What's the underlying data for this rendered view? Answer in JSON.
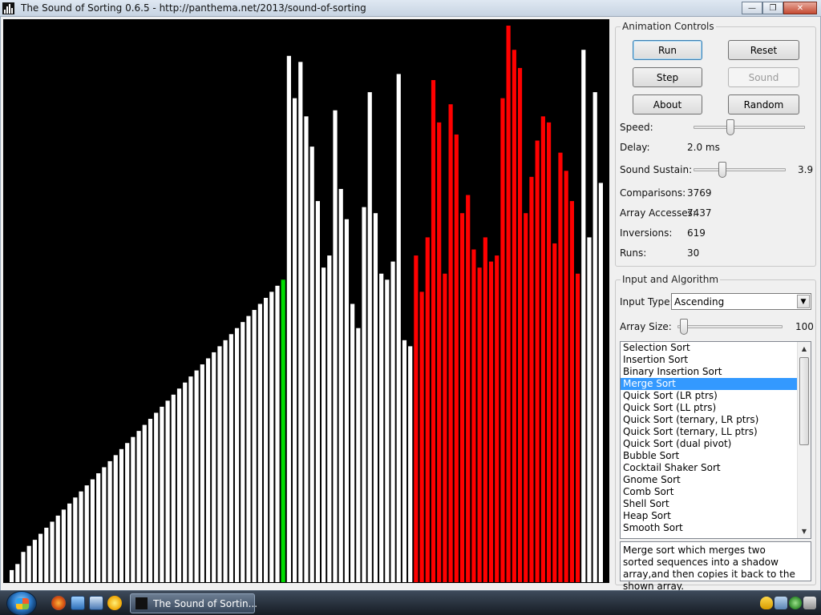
{
  "window": {
    "title": "The Sound of Sorting 0.6.5 - http://panthema.net/2013/sound-of-sorting",
    "minimize_glyph": "—",
    "maximize_glyph": "❐",
    "close_glyph": "✕"
  },
  "animation_controls": {
    "legend": "Animation Controls",
    "run_label": "Run",
    "reset_label": "Reset",
    "step_label": "Step",
    "sound_label": "Sound",
    "about_label": "About",
    "random_label": "Random",
    "speed_label": "Speed:",
    "speed_level": 0.33,
    "delay_label": "Delay:",
    "delay_value": "2.0 ms",
    "sustain_label": "Sound Sustain:",
    "sustain_level": 0.31,
    "sustain_value": "3.9",
    "comparisons_label": "Comparisons:",
    "comparisons_value": "3769",
    "accesses_label": "Array Accesses:",
    "accesses_value": "7437",
    "inversions_label": "Inversions:",
    "inversions_value": "619",
    "runs_label": "Runs:",
    "runs_value": "30"
  },
  "input_algorithm": {
    "legend": "Input and Algorithm",
    "input_type_label": "Input Type:",
    "input_type_value": "Ascending",
    "array_size_label": "Array Size:",
    "array_size_level": 0.06,
    "array_size_value": "100",
    "algorithms": [
      "Selection Sort",
      "Insertion Sort",
      "Binary Insertion Sort",
      "Merge Sort",
      "Quick Sort (LR ptrs)",
      "Quick Sort (LL ptrs)",
      "Quick Sort (ternary, LR ptrs)",
      "Quick Sort (ternary, LL ptrs)",
      "Quick Sort (dual pivot)",
      "Bubble Sort",
      "Cocktail Shaker Sort",
      "Gnome Sort",
      "Comb Sort",
      "Shell Sort",
      "Heap Sort",
      "Smooth Sort"
    ],
    "selected_index": 3,
    "description": "Merge sort which merges two sorted sequences into a shadow array,and then copies it back to the shown array."
  },
  "array_view": {
    "colors": {
      "normal": "#ffffff",
      "marked": "#ff0000",
      "active": "#00dd00",
      "background": "#000000"
    },
    "max_value": 92,
    "values": [
      2,
      3,
      5,
      6,
      7,
      8,
      9,
      10,
      11,
      12,
      13,
      14,
      15,
      16,
      17,
      18,
      19,
      20,
      21,
      22,
      23,
      24,
      25,
      26,
      27,
      28,
      29,
      30,
      31,
      32,
      33,
      34,
      35,
      36,
      37,
      38,
      39,
      40,
      41,
      42,
      43,
      44,
      45,
      46,
      47,
      48,
      49,
      50,
      87,
      80,
      86,
      77,
      72,
      63,
      52,
      54,
      78,
      65,
      60,
      46,
      42,
      62,
      81,
      61,
      51,
      50,
      53,
      84,
      40,
      39,
      54,
      48,
      57,
      83,
      76,
      51,
      79,
      74,
      61,
      64,
      55,
      52,
      57,
      53,
      54,
      80,
      92,
      88,
      85,
      61,
      67,
      73,
      77,
      76,
      56,
      71,
      68,
      63,
      51,
      88,
      57,
      81,
      66
    ],
    "states": "nnnnnnnnnnnnnnnnnnnnnnnnnnnnnnnnnnnnnnnnnnnnnnnannnnnnnnnnnnnnnnnnnnnnmmmmmmmmmmmmmmmmmmmmmmmmmmmmmnnnnn"
  },
  "taskbar": {
    "task_label": "The Sound of Sortin..."
  }
}
